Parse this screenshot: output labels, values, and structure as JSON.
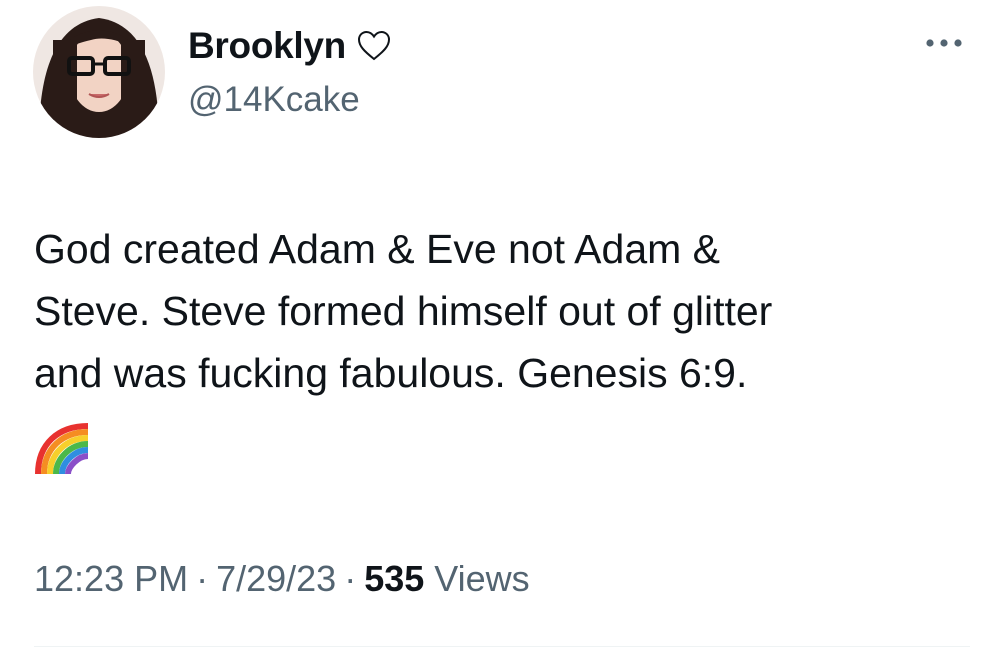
{
  "author": {
    "display_name": "Brooklyn",
    "handle": "@14Kcake",
    "badge_icon": "heart-outline-icon"
  },
  "more_menu_icon": "ellipsis-icon",
  "tweet": {
    "text": "God created Adam & Eve not Adam &\nSteve. Steve formed himself out of glitter\nand was fucking fabulous. Genesis 6:9.",
    "emoji": "rainbow-icon"
  },
  "meta": {
    "time": "12:23 PM",
    "separator": "·",
    "date": "7/29/23",
    "views_count": "535",
    "views_label": "Views"
  },
  "colors": {
    "text_primary": "#0f1419",
    "text_secondary": "#536471",
    "divider": "#eff3f4"
  }
}
